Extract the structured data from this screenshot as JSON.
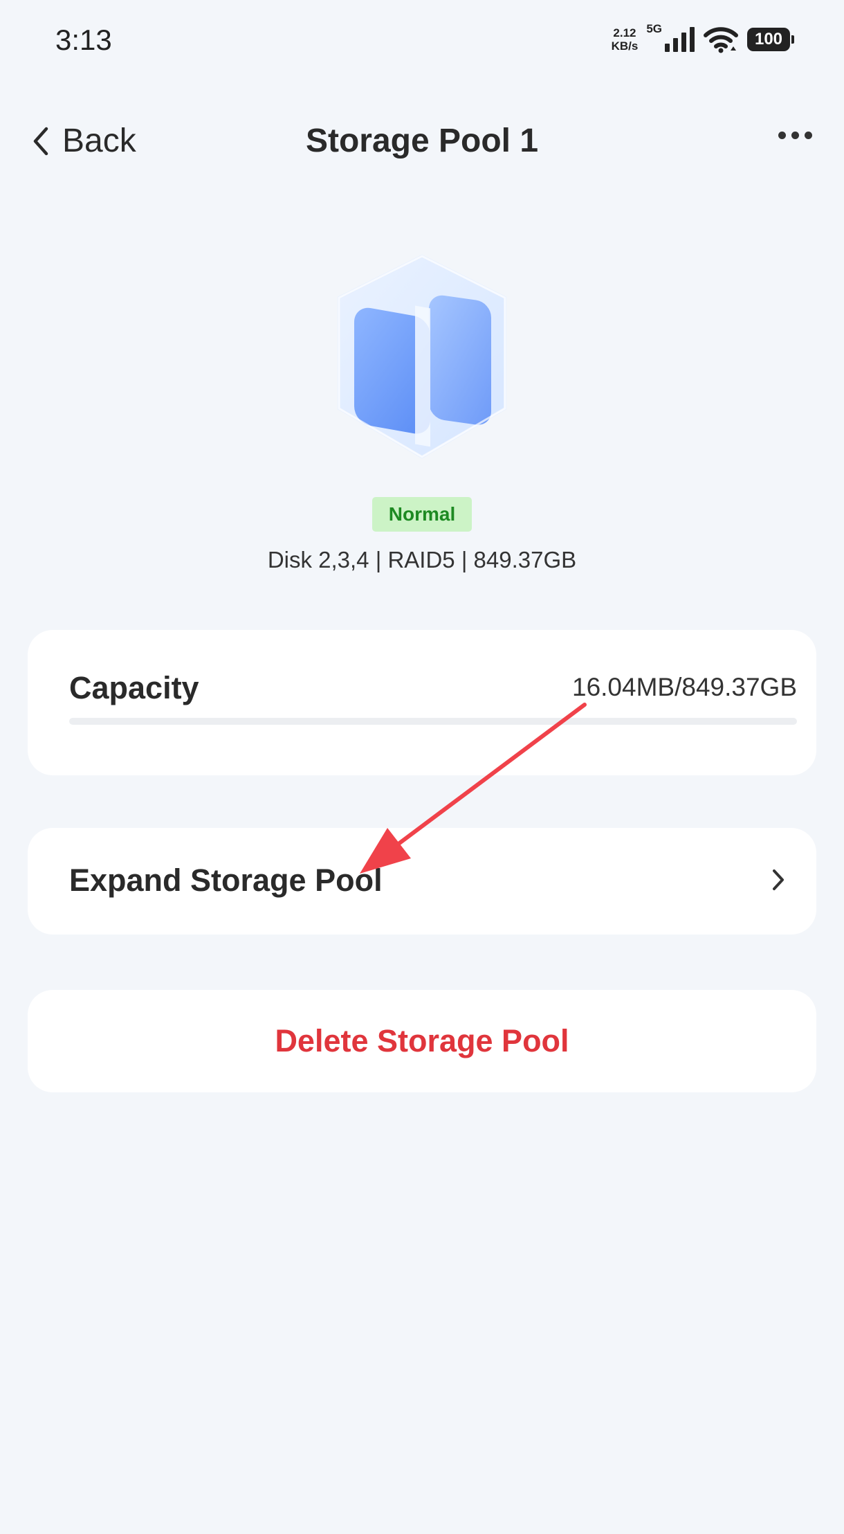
{
  "status_bar": {
    "time": "3:13",
    "net_speed_value": "2.12",
    "net_speed_unit": "KB/s",
    "network": "5G",
    "battery": "100"
  },
  "nav": {
    "back_label": "Back",
    "title": "Storage Pool 1",
    "more_icon": "more-icon"
  },
  "pool": {
    "icon": "storage-pool-icon",
    "status": "Normal",
    "status_color": "#1d8a22",
    "summary": "Disk 2,3,4 | RAID5 | 849.37GB"
  },
  "capacity": {
    "label": "Capacity",
    "value": "16.04MB/849.37GB",
    "used_fraction": 2e-05
  },
  "actions": {
    "expand_label": "Expand Storage Pool",
    "delete_label": "Delete Storage Pool",
    "delete_color": "#e0353c"
  },
  "annotation": {
    "arrow_color": "#f0424a"
  }
}
